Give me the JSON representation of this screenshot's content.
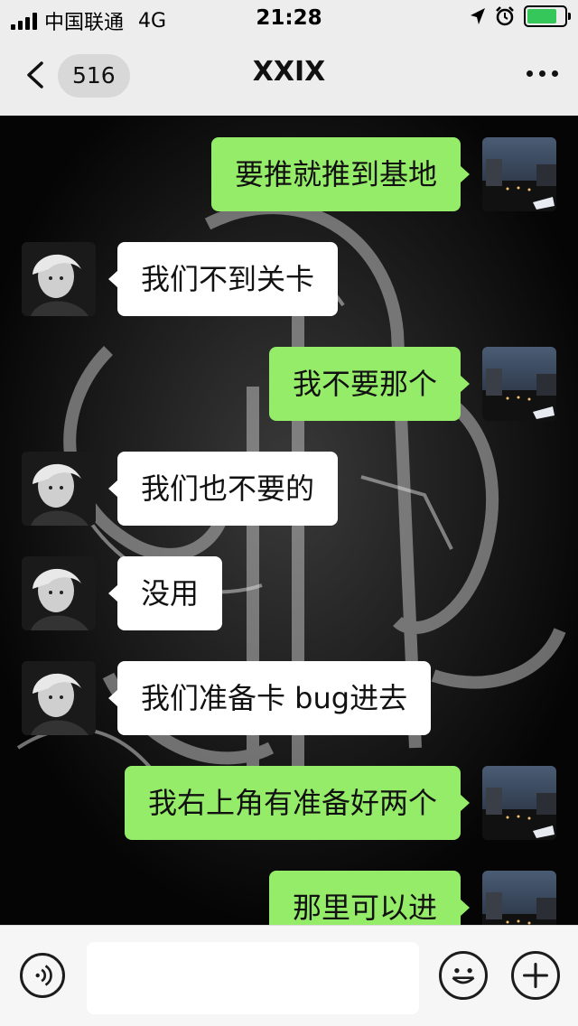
{
  "status_bar": {
    "carrier": "中国联通",
    "network": "4G",
    "time": "21:28",
    "battery_color": "#35c759",
    "battery_level": 0.8,
    "icons": [
      "location-icon",
      "alarm-icon",
      "battery-icon"
    ]
  },
  "header": {
    "unread_count": "516",
    "title": "XXIX",
    "icons": [
      "back-icon",
      "more-icon"
    ]
  },
  "chat": {
    "colors": {
      "outgoing_bubble": "#95ec69",
      "incoming_bubble": "#ffffff"
    },
    "messages": [
      {
        "side": "right",
        "text": "要推就推到基地"
      },
      {
        "side": "left",
        "text": "我们不到关卡"
      },
      {
        "side": "right",
        "text": "我不要那个"
      },
      {
        "side": "left",
        "text": "我们也不要的"
      },
      {
        "side": "left",
        "text": "没用"
      },
      {
        "side": "left",
        "text": "我们准备卡 bug进去"
      },
      {
        "side": "right",
        "text": "我右上角有准备好两个"
      },
      {
        "side": "right",
        "text": "那里可以进"
      }
    ]
  },
  "input_bar": {
    "input_value": "",
    "icons": [
      "voice-icon",
      "emoji-icon",
      "plus-icon"
    ]
  }
}
